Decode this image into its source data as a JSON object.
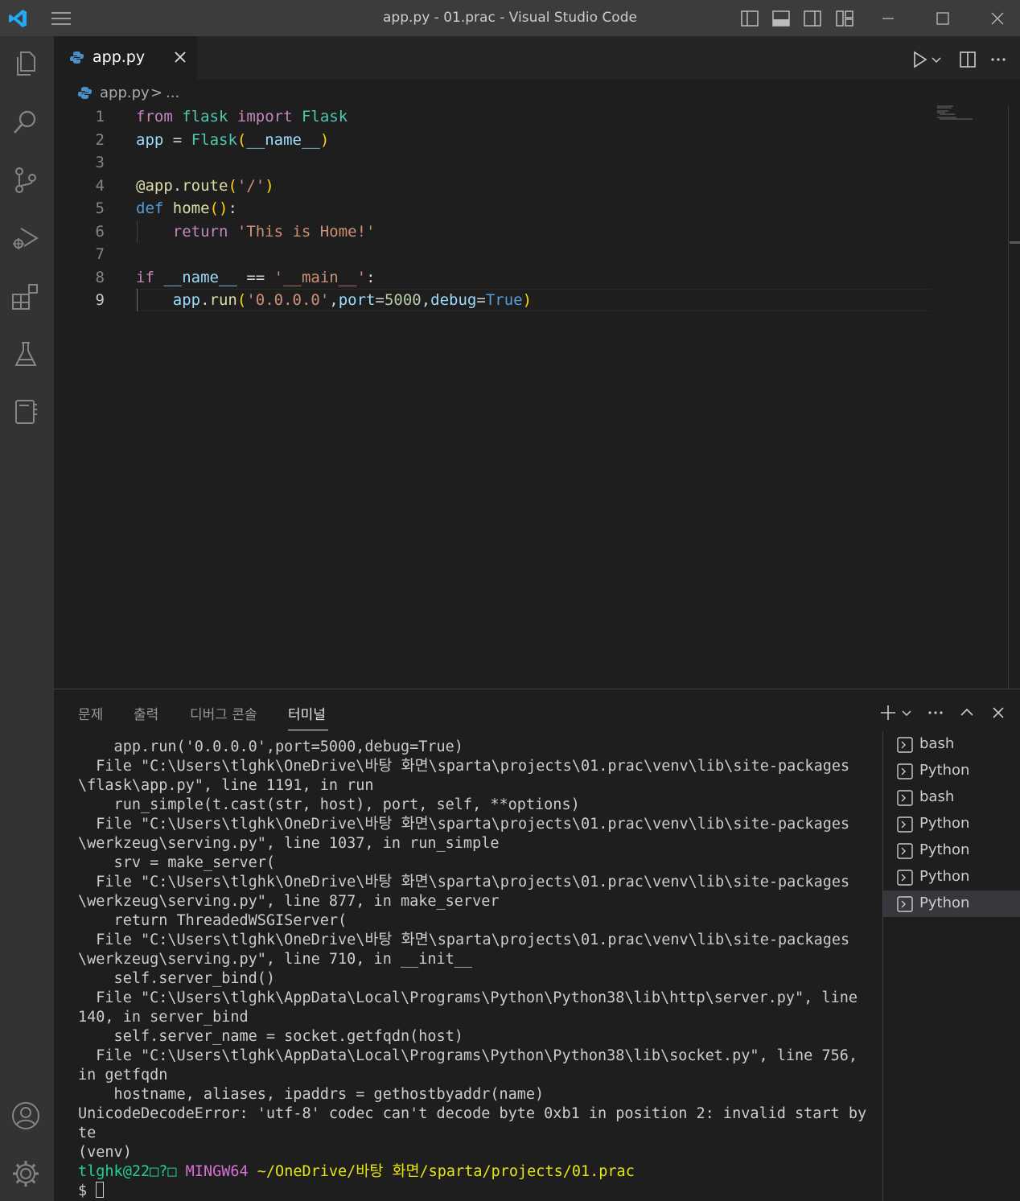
{
  "window": {
    "title": "app.py - 01.prac - Visual Studio Code"
  },
  "activity_bar": {
    "items": [
      "explorer-icon",
      "search-icon",
      "source-control-icon",
      "run-debug-icon",
      "extensions-icon",
      "testing-icon",
      "notebook-icon"
    ],
    "bottom": [
      "account-icon",
      "settings-gear-icon"
    ]
  },
  "editor": {
    "tab_label": "app.py",
    "breadcrumb_file": "app.py",
    "breadcrumb_sep": ">",
    "breadcrumb_more": "...",
    "active_line": 9,
    "lines": [
      {
        "n": "1",
        "text": "from flask import Flask"
      },
      {
        "n": "2",
        "text": "app = Flask(__name__)"
      },
      {
        "n": "3",
        "text": ""
      },
      {
        "n": "4",
        "text": "@app.route('/')"
      },
      {
        "n": "5",
        "text": "def home():"
      },
      {
        "n": "6",
        "text": "    return 'This is Home!'"
      },
      {
        "n": "7",
        "text": ""
      },
      {
        "n": "8",
        "text": "if __name__ == '__main__':"
      },
      {
        "n": "9",
        "text": "    app.run('0.0.0.0',port=5000,debug=True)"
      }
    ]
  },
  "panel": {
    "tabs": [
      "문제",
      "출력",
      "디버그 콘솔",
      "터미널"
    ],
    "active_tab": "터미널",
    "terminal_lines": [
      "    app.run('0.0.0.0',port=5000,debug=True)",
      "  File \"C:\\Users\\tlghk\\OneDrive\\바탕 화면\\sparta\\projects\\01.prac\\venv\\lib\\site-packages",
      "\\flask\\app.py\", line 1191, in run",
      "    run_simple(t.cast(str, host), port, self, **options)",
      "  File \"C:\\Users\\tlghk\\OneDrive\\바탕 화면\\sparta\\projects\\01.prac\\venv\\lib\\site-packages",
      "\\werkzeug\\serving.py\", line 1037, in run_simple",
      "    srv = make_server(",
      "  File \"C:\\Users\\tlghk\\OneDrive\\바탕 화면\\sparta\\projects\\01.prac\\venv\\lib\\site-packages",
      "\\werkzeug\\serving.py\", line 877, in make_server",
      "    return ThreadedWSGIServer(",
      "  File \"C:\\Users\\tlghk\\OneDrive\\바탕 화면\\sparta\\projects\\01.prac\\venv\\lib\\site-packages",
      "\\werkzeug\\serving.py\", line 710, in __init__",
      "    self.server_bind()",
      "  File \"C:\\Users\\tlghk\\AppData\\Local\\Programs\\Python\\Python38\\lib\\http\\server.py\", line",
      "140, in server_bind",
      "    self.server_name = socket.getfqdn(host)",
      "  File \"C:\\Users\\tlghk\\AppData\\Local\\Programs\\Python\\Python38\\lib\\socket.py\", line 756,",
      "in getfqdn",
      "    hostname, aliases, ipaddrs = gethostbyaddr(name)",
      "UnicodeDecodeError: 'utf-8' codec can't decode byte 0xb1 in position 2: invalid start by",
      "te",
      "(venv)"
    ],
    "prompt": {
      "user": "tlghk@22□?□",
      "host": "MINGW64",
      "path": "~/OneDrive/바탕 화면/sparta/projects/01.prac",
      "symbol": "$"
    },
    "terminals": [
      "bash",
      "Python",
      "bash",
      "Python",
      "Python",
      "Python",
      "Python"
    ],
    "selected_terminal": 7
  },
  "colors": {
    "accent_vscode": "#23a9f2",
    "keyword": "#c586c0",
    "string": "#ce9178",
    "function": "#dcdcaa",
    "prompt_green": "#23d18b",
    "prompt_magenta": "#d670d6",
    "prompt_yellow": "#e5e510"
  }
}
